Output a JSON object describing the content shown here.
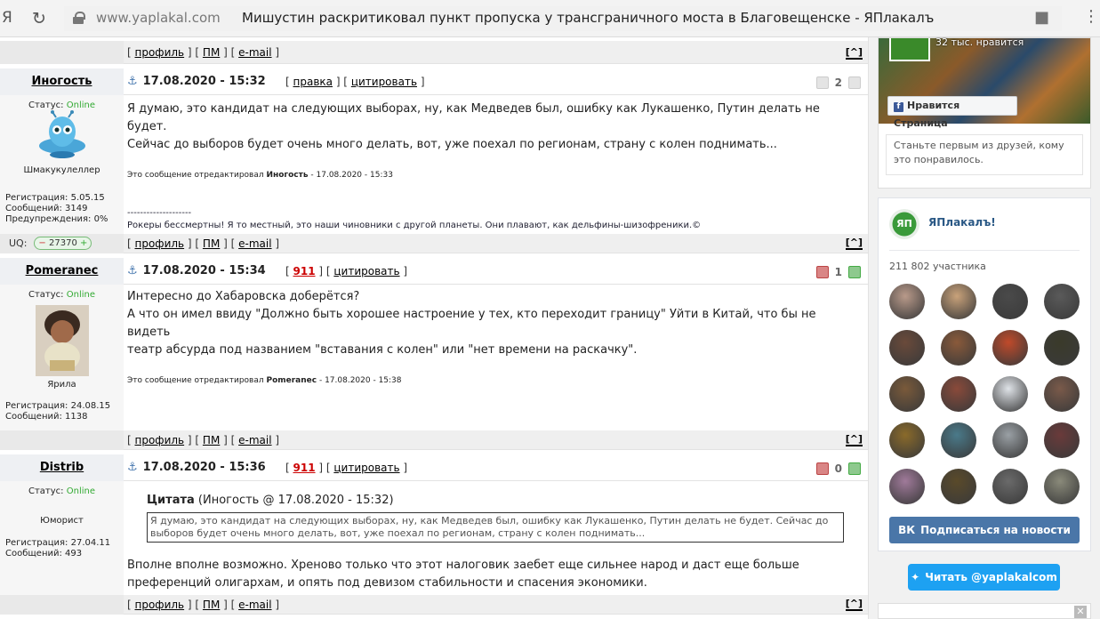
{
  "browser": {
    "url": "www.yaplakal.com",
    "title": "Мишустин раскритиковал пункт пропуска у трансграничного моста в Благовещенске - ЯПлакалъ"
  },
  "controls": {
    "profile": "профиль",
    "pm": "ПМ",
    "email": "e-mail",
    "up": "[^]",
    "edit": "правка",
    "quote": "цитировать",
    "status_label": "Статус:",
    "status_online": "Online",
    "uq_label": "UQ:",
    "uq_value": "27370"
  },
  "posts": [
    {
      "nick": "Иногость",
      "date": "17.08.2020 - 15:32",
      "rating": "2",
      "avatar_label": "Шмакукулеллер",
      "reg": [
        "Регистрация: 5.05.15",
        "Сообщений: 3149",
        "Предупреждения: 0%"
      ],
      "text": [
        "Я думаю, это кандидат на следующих выборах, ну, как Медведев был, ошибку как Лукашенко, Путин делать не будет.",
        "Сейчас до выборов будет очень много делать, вот, уже поехал по регионам, страну с колен поднимать..."
      ],
      "edited_prefix": "Это сообщение отредактировал ",
      "edited_by": "Иногость",
      "edited_date": " - 17.08.2020 - 15:33",
      "sig_line": "--------------------",
      "sig": "Рокеры бессмертны! Я то местный, это наши чиновники с другой планеты. Они плавают, как дельфины-шизофреники.©"
    },
    {
      "nick": "Pomeranec",
      "date": "17.08.2020 - 15:34",
      "code": "911",
      "rating": "1",
      "avatar_label": "Ярила",
      "reg": [
        "Регистрация: 24.08.15",
        "Сообщений: 1138"
      ],
      "text": [
        "Интересно до Хабаровска доберётся?",
        "А что он имел ввиду \"Должно быть хорошее настроение у тех, кто переходит границу\" Уйти в Китай, что бы не видеть",
        "театр абсурда под названием \"вставания с колен\" или \"нет времени на раскачку\"."
      ],
      "edited_prefix": "Это сообщение отредактировал ",
      "edited_by": "Pomeranec",
      "edited_date": " - 17.08.2020 - 15:38"
    },
    {
      "nick": "Distrib",
      "date": "17.08.2020 - 15:36",
      "code": "911",
      "rating": "0",
      "avatar_label": "Юморист",
      "reg": [
        "Регистрация: 27.04.11",
        "Сообщений: 493"
      ],
      "quote_title": "Цитата",
      "quote_meta": " (Иногость @ 17.08.2020 - 15:32)",
      "quote_text": "Я думаю, это кандидат на следующих выборах, ну, как Медведев был, ошибку как Лукашенко, Путин делать не будет. Сейчас до выборов будет очень много делать, вот, уже поехал по регионам, страну с колен поднимать...",
      "text": [
        "Вполне вполне возможно. Хреново только что этот налоговик заебет еще сильнее народ и даст еще больше",
        "преференций олигархам, и опять под девизом стабильности и спасения экономики."
      ]
    }
  ],
  "sidebar": {
    "fb_likes": "32 тыс. нравится",
    "fb_like_btn": "Нравится Страница",
    "fb_friends": "Станьте первым из друзей, кому это понравилось.",
    "vk_name": "ЯПлакалъ!",
    "vk_logo": "ЯП",
    "vk_members": "211 802 участника",
    "vk_subscribe": "Подписаться на новости",
    "tw_read": "Читать @yaplakalcom",
    "avatar_colors": [
      "#b99a8a",
      "#c9a27a",
      "#4a4a4a",
      "#5a5a5a",
      "#6a4a3a",
      "#8a5a3a",
      "#c04a2a",
      "#3a3a2a",
      "#7a5a3a",
      "#8a4a3a",
      "#dfe3e8",
      "#7a5a4a",
      "#8a6a2a",
      "#4a7a8a",
      "#9aa0a5",
      "#6a3a3a",
      "#a07a9a",
      "#5a4a2a",
      "#6a6a6a",
      "#8a8a7a"
    ]
  }
}
